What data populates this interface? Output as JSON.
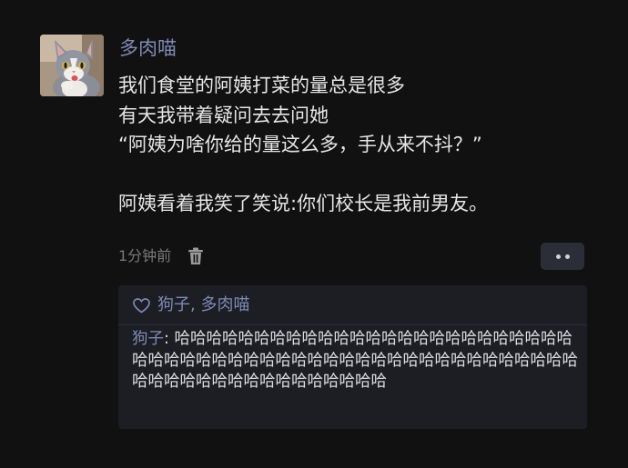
{
  "post": {
    "author": "多肉喵",
    "lines": [
      "我们食堂的阿姨打菜的量总是很多",
      "有天我带着疑问去去问她",
      "“阿姨为啥你给的量这么多，手从来不抖？”",
      "",
      "阿姨看着我笑了笑说:你们校长是我前男友。"
    ],
    "time": "1分钟前"
  },
  "likes": {
    "names": "狗子, 多肉喵"
  },
  "comments": [
    {
      "author": "狗子",
      "separator": ": ",
      "text": "哈哈哈哈哈哈哈哈哈哈哈哈哈哈哈哈哈哈哈哈哈哈哈哈哈哈哈哈哈哈哈哈哈哈哈哈哈哈哈哈哈哈哈哈哈哈哈哈哈哈哈哈哈哈哈哈哈哈哈哈哈哈哈哈哈哈哈哈哈"
    }
  ],
  "colors": {
    "background": "#111111",
    "accent_name": "#7e8ab5",
    "panel": "#1c1e24",
    "text": "#e6e6e6"
  },
  "icons": {
    "avatar": "cat-photo",
    "delete": "trash-icon",
    "more": "more-dots-icon",
    "like": "heart-icon"
  }
}
